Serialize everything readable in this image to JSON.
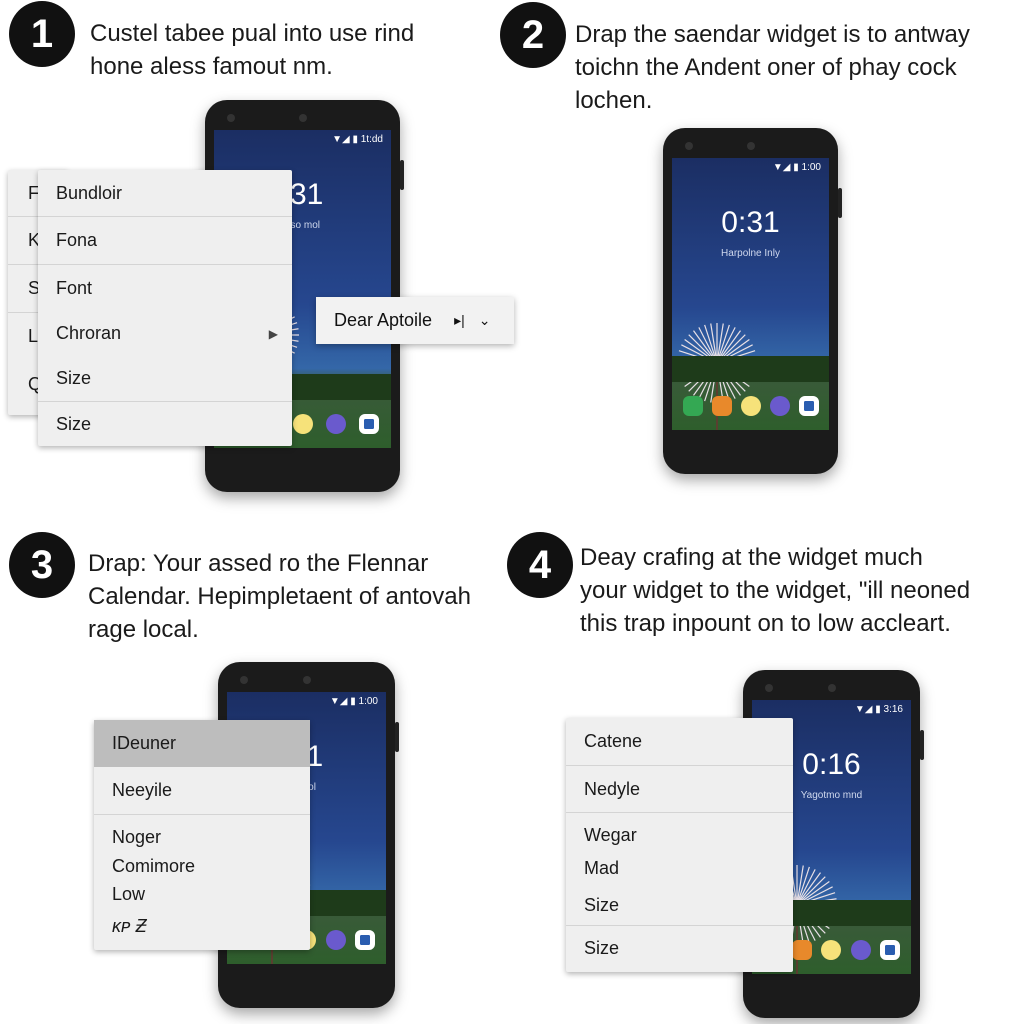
{
  "steps": [
    {
      "number": "1",
      "lines": [
        "Custel tabee pual into use rind",
        "hone aless famout nm."
      ]
    },
    {
      "number": "2",
      "lines": [
        "Drap the saendar widget is to antway",
        "toichn the Andent oner of phay cock",
        "lochen."
      ]
    },
    {
      "number": "3",
      "lines": [
        "Drap: Your assed ro the Flennar",
        "Calendar. Hepimpletaent of antovah",
        "rage local."
      ]
    },
    {
      "number": "4",
      "lines": [
        "Deay crafing at the widget much",
        "your widget to the widget, \"ill neoned",
        "this trap inpount on to low accleart."
      ]
    }
  ],
  "phones": [
    {
      "status": "1t:dd",
      "clock": ":31",
      "sub": "aso mol"
    },
    {
      "status": "1:00",
      "clock": "0:31",
      "sub": "Harpolne Inly"
    },
    {
      "status": "1:00",
      "clock": "31",
      "sub": "hhol"
    },
    {
      "status": "3:16",
      "clock": "0:16",
      "sub": "Yagotmo mnd"
    }
  ],
  "menu1_back": [
    "F",
    "K",
    "S",
    "L",
    "Q"
  ],
  "menu1": [
    "Bundloir",
    "Fona",
    "Font",
    "Chroran",
    "Size",
    "Size"
  ],
  "popup1": {
    "label": "Dear Aptoile"
  },
  "menu3": [
    "IDeuner",
    "Neeyile",
    "Noger",
    "Comimore",
    "Low",
    "ᴋᴘ Ƶ"
  ],
  "menu4": [
    "Catene",
    "Nedyle",
    "Wegar",
    "Mad",
    "Size",
    "Size"
  ],
  "colors": {
    "badge": "#111111",
    "menu": "#efefef",
    "highlight": "#bdbdbd",
    "screen": "#26478f"
  }
}
